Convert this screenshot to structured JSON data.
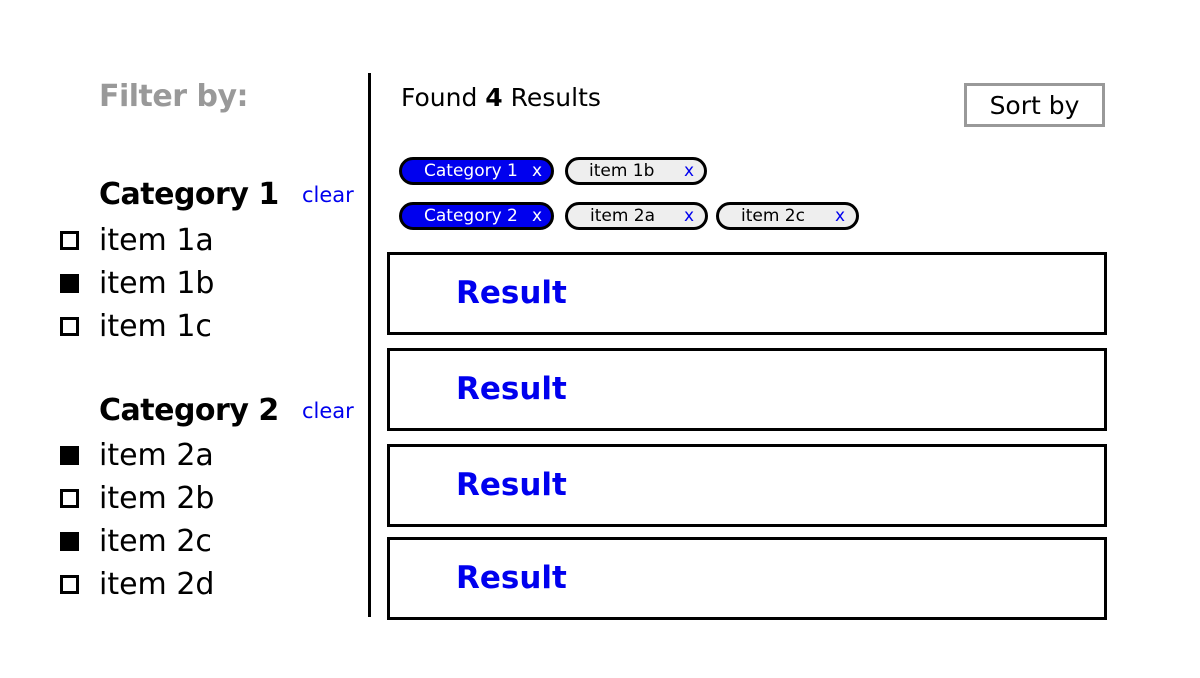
{
  "sidebar": {
    "title": "Filter by:",
    "categories": [
      {
        "name": "Category 1",
        "clear_label": "clear",
        "items": [
          {
            "label": "item 1a",
            "checked": false
          },
          {
            "label": "item 1b",
            "checked": true
          },
          {
            "label": "item 1c",
            "checked": false
          }
        ]
      },
      {
        "name": "Category 2",
        "clear_label": "clear",
        "items": [
          {
            "label": "item 2a",
            "checked": true
          },
          {
            "label": "item 2b",
            "checked": false
          },
          {
            "label": "item 2c",
            "checked": true
          },
          {
            "label": "item 2d",
            "checked": false
          }
        ]
      }
    ]
  },
  "main": {
    "found_prefix": "Found",
    "found_count": "4",
    "found_suffix": "Results",
    "sort_label": "Sort by",
    "chips": {
      "row1": [
        {
          "label": "Category 1",
          "remove": "x",
          "kind": "category"
        },
        {
          "label": "item 1b",
          "remove": "x",
          "kind": "item"
        }
      ],
      "row2": [
        {
          "label": "Category 2",
          "remove": "x",
          "kind": "category"
        },
        {
          "label": "item 2a",
          "remove": "x",
          "kind": "item"
        },
        {
          "label": "item 2c",
          "remove": "x",
          "kind": "item"
        }
      ]
    },
    "results": [
      {
        "label": "Result"
      },
      {
        "label": "Result"
      },
      {
        "label": "Result"
      },
      {
        "label": "Result"
      }
    ]
  },
  "colors": {
    "accent": "#0000ee",
    "muted": "#999999",
    "chip_bg": "#eeeeee"
  }
}
